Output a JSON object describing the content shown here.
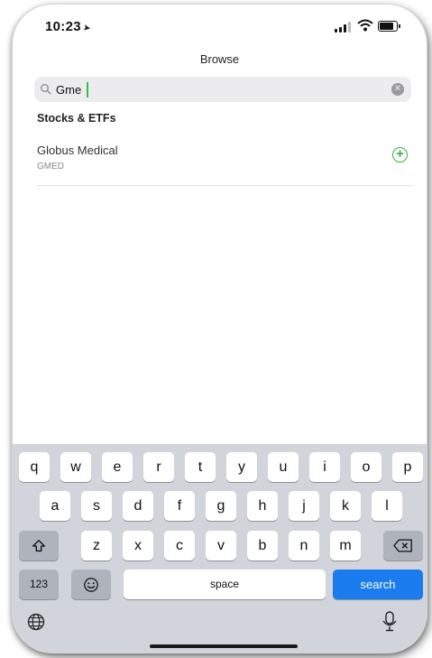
{
  "status_bar": {
    "time": "10:23"
  },
  "nav": {
    "title": "Browse"
  },
  "search": {
    "value": "Gme"
  },
  "results": {
    "section_title": "Stocks & ETFs",
    "items": [
      {
        "name": "Globus Medical",
        "ticker": "GMED"
      }
    ]
  },
  "keyboard": {
    "row1": [
      "q",
      "w",
      "e",
      "r",
      "t",
      "y",
      "u",
      "i",
      "o",
      "p"
    ],
    "row2": [
      "a",
      "s",
      "d",
      "f",
      "g",
      "h",
      "j",
      "k",
      "l"
    ],
    "row3": [
      "z",
      "x",
      "c",
      "v",
      "b",
      "n",
      "m"
    ],
    "numbers_label": "123",
    "space_label": "space",
    "search_label": "search"
  },
  "colors": {
    "accent_green": "#34b34a",
    "search_key_blue": "#1b7cf0",
    "keyboard_bg": "#d1d4da"
  }
}
